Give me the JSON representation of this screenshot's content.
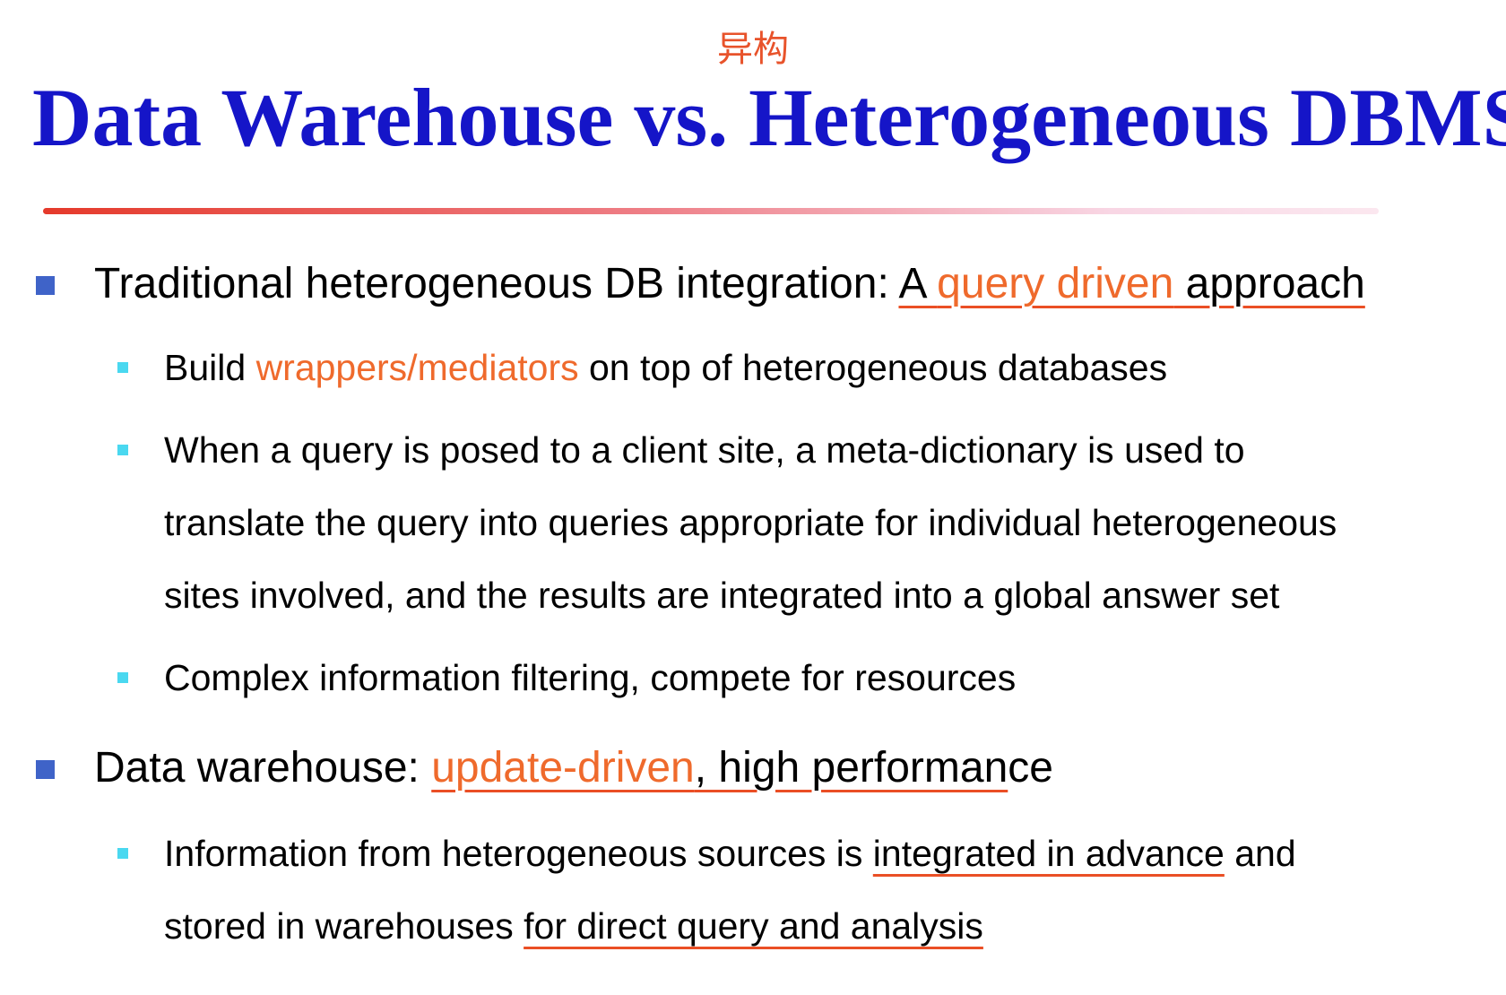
{
  "annotation": "异构",
  "title": "Data Warehouse vs. Heterogeneous DBMS",
  "bullets": [
    {
      "parts": [
        "Traditional heterogeneous DB integration: ",
        "A ",
        "query driven",
        " approach"
      ],
      "subs": [
        {
          "parts": [
            "Build ",
            "wrappers/mediators",
            " on top of heterogeneous databases"
          ]
        },
        {
          "lines": [
            "When a query is posed to a client site, a meta-dictionary is used to",
            "translate the query into queries appropriate for individual heterogeneous",
            "sites involved, and the results are integrated into a global answer set"
          ]
        },
        {
          "text": "Complex information filtering, compete for resources"
        }
      ]
    },
    {
      "parts": [
        "Data warehouse: ",
        "update-driven",
        ", high performan",
        "ce"
      ],
      "subs": [
        {
          "line1": [
            "Information from heterogeneous sources is ",
            "integrated in advance",
            " and"
          ],
          "line2": [
            "stored in warehouses ",
            "for direct query and analysis"
          ]
        }
      ]
    }
  ],
  "colors": {
    "title": "#1515c8",
    "accent": "#ef6a2c",
    "underline": "#ea4f25",
    "bullet_square": "#3f63c8",
    "sub_square": "#4ad8f0"
  }
}
